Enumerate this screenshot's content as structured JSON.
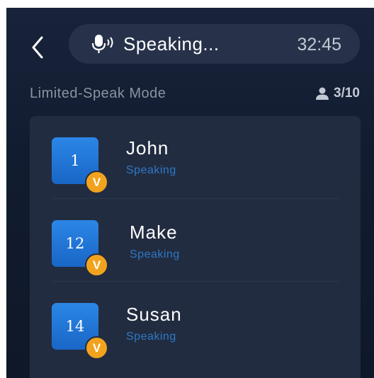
{
  "header": {
    "back_icon": "chevron-left-icon",
    "mic_icon": "microphone-speaking-icon",
    "status_label": "Speaking...",
    "timer": "32:45"
  },
  "mode": {
    "title": "Limited-Speak Mode",
    "person_icon": "person-icon",
    "count": "3/10"
  },
  "participants": [
    {
      "number": "1",
      "badge": "V",
      "name": "John",
      "status": "Speaking"
    },
    {
      "number": "12",
      "badge": "V",
      "name": "Make",
      "status": "Speaking"
    },
    {
      "number": "14",
      "badge": "V",
      "name": "Susan",
      "status": "Speaking"
    }
  ],
  "colors": {
    "accent_blue": "#1f74d6",
    "badge_gold": "#f2a31d",
    "status_blue": "#2d79c7"
  }
}
